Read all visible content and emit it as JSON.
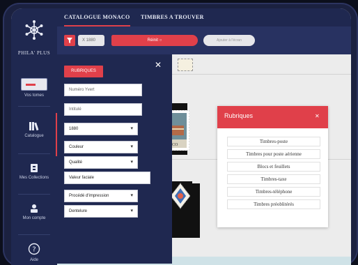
{
  "app": {
    "brand": "PHILA' PLUS"
  },
  "tabs": [
    {
      "label": "CATALOGUE MONACO"
    },
    {
      "label": "TIMBRES A TROUVER"
    }
  ],
  "sidebar": {
    "items": [
      {
        "label": "Vos tomes"
      },
      {
        "label": "Catalogue"
      },
      {
        "label": "Mes Collections"
      },
      {
        "label": "Mon compte"
      },
      {
        "label": "Aide"
      }
    ]
  },
  "filterbar": {
    "year_value": "X 1880",
    "reset_label": "Réinit",
    "collection_label": "Ajouter à l'écran"
  },
  "panel": {
    "rubriques_label": "RUBRIQUES",
    "numero_placeholder": "Numéro Yvert",
    "intitule_placeholder": "Intitulé",
    "year_value": "1880",
    "couleur_value": "Couleur",
    "qualite_value": "Qualité",
    "valeur_placeholder": "Valeur faciale",
    "procede_value": "Procédé d'impression",
    "dentelure_value": "Dentelure"
  },
  "modal": {
    "title": "Rubriques",
    "items": [
      "Timbres-poste",
      "Timbres pour poste aérienne",
      "Blocs et feuillets",
      "Timbres-taxe",
      "Timbres-téléphone",
      "Timbres préoblitérés"
    ]
  },
  "gallery": {
    "stamp_caption": "MONACO"
  },
  "colors": {
    "navy": "#1f2850",
    "accent_red": "#e0404a",
    "content_bg": "#ececec"
  }
}
